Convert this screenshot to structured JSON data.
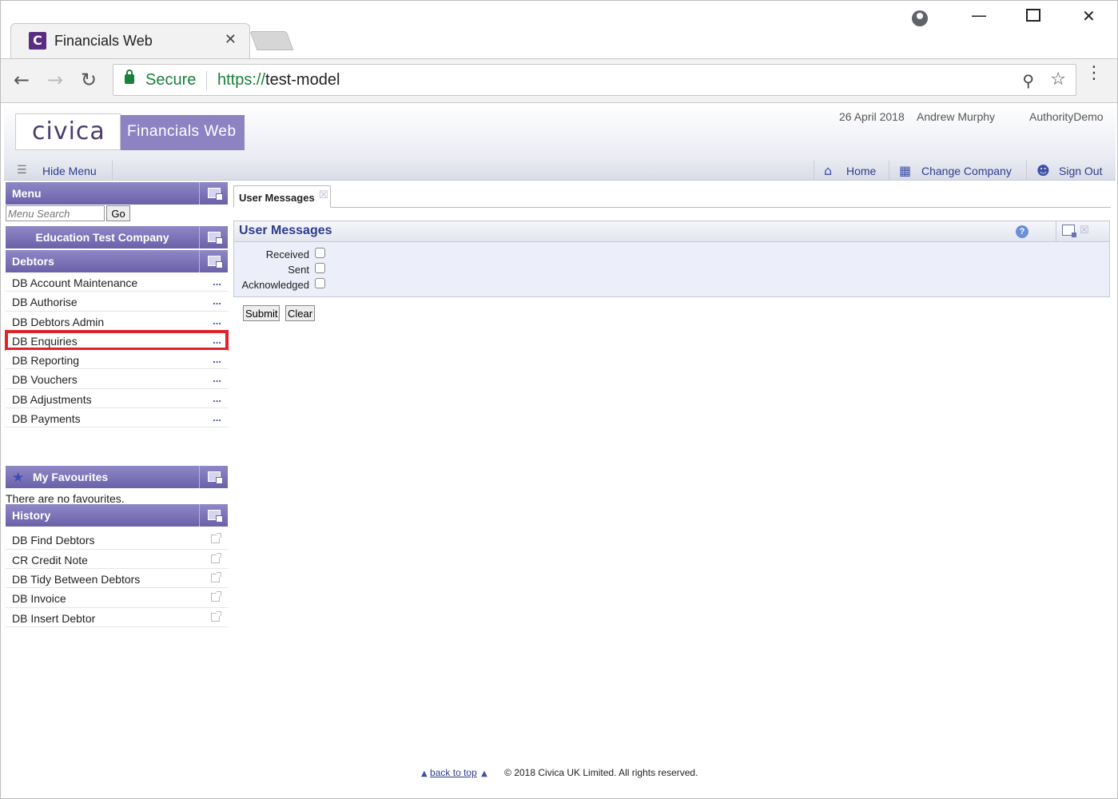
{
  "browser": {
    "tab_title": "Financials Web",
    "tab_close": "✕",
    "favicon_letter": "C",
    "secure_label": "Secure",
    "url_scheme": "https://",
    "url_host": "test-model",
    "icons": [
      "back-icon",
      "forward-icon",
      "reload-icon",
      "lock-icon",
      "zoom-icon",
      "star-icon",
      "kebab-icon",
      "profile-icon",
      "minimize-icon",
      "maximize-icon",
      "close-icon"
    ]
  },
  "header": {
    "logo": "civica",
    "product": "Financials Web",
    "date": "26 April 2018",
    "user": "Andrew Murphy",
    "org": "AuthorityDemo"
  },
  "menubar": {
    "hide_menu": "Hide Menu",
    "home": "Home",
    "change_company": "Change Company",
    "sign_out": "Sign Out"
  },
  "sidebar": {
    "menu_title": "Menu",
    "search_placeholder": "Menu Search",
    "go_label": "Go",
    "company": "Education Test Company",
    "module": "Debtors",
    "items": [
      {
        "label": "DB Account Maintenance",
        "more": "..."
      },
      {
        "label": "DB Authorise",
        "more": "..."
      },
      {
        "label": "DB Debtors Admin",
        "more": "..."
      },
      {
        "label": "DB Enquiries",
        "more": "..."
      },
      {
        "label": "DB Reporting",
        "more": "..."
      },
      {
        "label": "DB Vouchers",
        "more": "..."
      },
      {
        "label": "DB Adjustments",
        "more": "..."
      },
      {
        "label": "DB Payments",
        "more": "..."
      }
    ],
    "favourites_title": "My Favourites",
    "no_favourites": "There are no favourites.",
    "history_title": "History",
    "history": [
      {
        "label": "DB Find Debtors"
      },
      {
        "label": "CR Credit Note"
      },
      {
        "label": "DB Tidy Between Debtors"
      },
      {
        "label": "DB Invoice"
      },
      {
        "label": "DB Insert Debtor"
      }
    ]
  },
  "main": {
    "tab_label": "User Messages",
    "panel_title": "User Messages",
    "help": "?",
    "checkboxes": [
      {
        "label": "Received",
        "checked": false
      },
      {
        "label": "Sent",
        "checked": false
      },
      {
        "label": "Acknowledged",
        "checked": false
      }
    ],
    "submit": "Submit",
    "clear": "Clear"
  },
  "footer": {
    "back_to_top": "back to top",
    "copyright": "© 2018 Civica UK Limited. All rights reserved."
  },
  "colors": {
    "brand_purple": "#6a61a9",
    "link_blue": "#2d3c8c",
    "highlight_red": "#e0232b",
    "secure_green": "#188038"
  }
}
